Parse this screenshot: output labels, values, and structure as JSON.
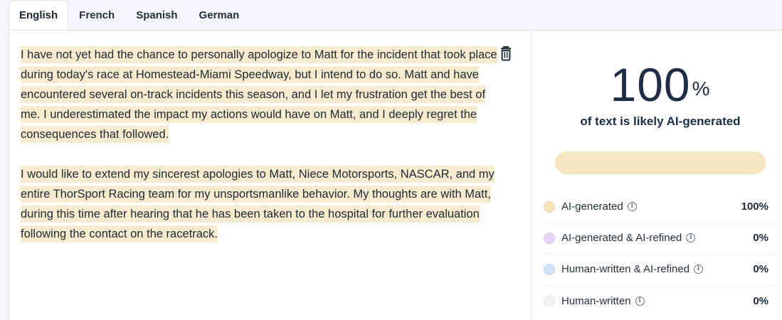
{
  "tabs": [
    {
      "label": "English",
      "active": true
    },
    {
      "label": "French",
      "active": false
    },
    {
      "label": "Spanish",
      "active": false
    },
    {
      "label": "German",
      "active": false
    }
  ],
  "document": {
    "paragraphs": [
      "I have not yet had the chance to personally apologize to Matt for the incident that took place during today's race at Homestead-Miami Speedway, but I intend to do so. Matt and have encountered several on-track incidents this season, and I let my frustration get the best of me. I underestimated the impact my actions would have on Matt, and I deeply regret the consequences that followed.",
      "I would like to extend my sincerest apologies to Matt, Niece Motorsports, NASCAR, and my entire ThorSport Racing team for my unsportsmanlike behavior. My thoughts are with Matt, during this time after hearing that he has been taken to the hospital for further evaluation following the contact on the racetrack."
    ],
    "highlight_color": "#f7ebcf",
    "delete_icon": "trash-icon"
  },
  "result": {
    "score_value": "100",
    "score_unit": "%",
    "caption": "of text is likely AI-generated",
    "bar_fill_fraction": 1.0,
    "bar_color": "#f3e6c1",
    "legend": [
      {
        "label": "AI-generated",
        "value": "100%",
        "color": "#f5e3b8"
      },
      {
        "label": "AI-generated & AI-refined",
        "value": "0%",
        "color": "#e6d4f5"
      },
      {
        "label": "Human-written & AI-refined",
        "value": "0%",
        "color": "#d3e4f7"
      },
      {
        "label": "Human-written",
        "value": "0%",
        "color": "#f1f2f4"
      }
    ],
    "info_icon": "info-icon"
  }
}
